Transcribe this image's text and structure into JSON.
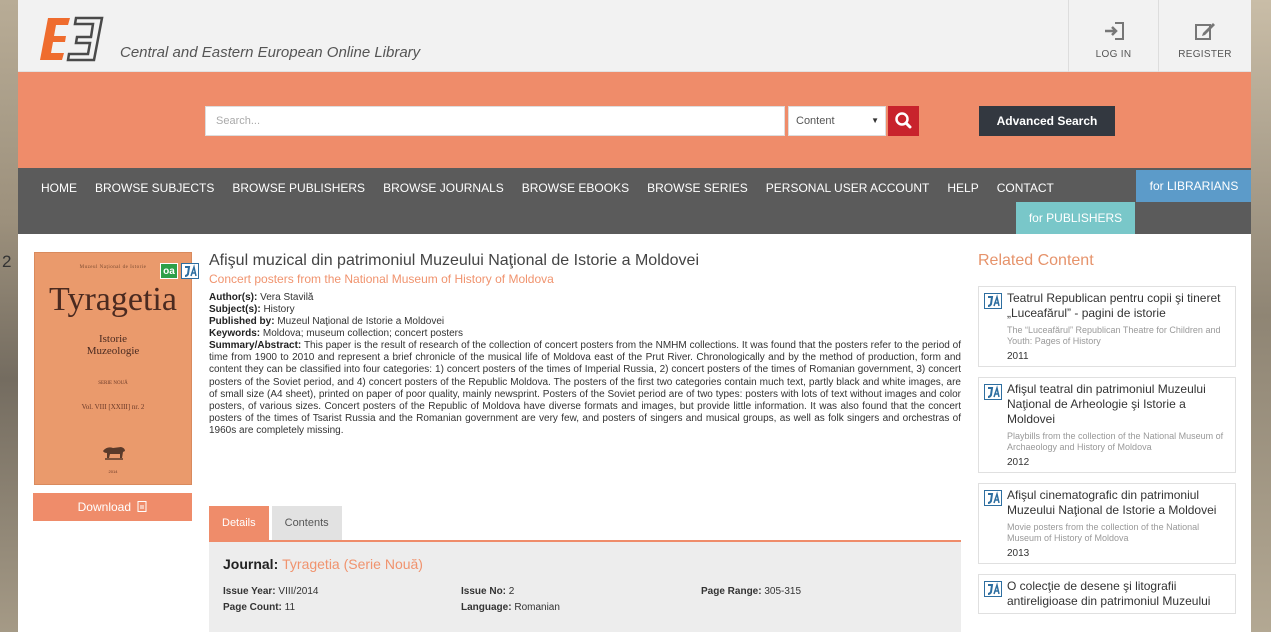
{
  "background": {
    "digit": "2"
  },
  "header": {
    "site_title": "Central and Eastern European Online Library",
    "login_label": "LOG IN",
    "register_label": "REGISTER"
  },
  "search": {
    "placeholder": "Search...",
    "select_value": "Content",
    "advanced_label": "Advanced Search"
  },
  "nav": {
    "items": [
      "HOME",
      "BROWSE SUBJECTS",
      "BROWSE PUBLISHERS",
      "BROWSE JOURNALS",
      "BROWSE EBOOKS",
      "BROWSE SERIES",
      "PERSONAL USER ACCOUNT",
      "HELP",
      "CONTACT"
    ],
    "for_librarians": "for LIBRARIANS",
    "for_publishers": "for PUBLISHERS"
  },
  "cover": {
    "top_text": "Muzeul Național de Istorie",
    "title": "Tyragetia",
    "subtitle1": "Istorie",
    "subtitle2": "Muzeologie",
    "series": "SERIE NOUĂ",
    "volume": "Vol. VIII [XXIII] nr. 2",
    "year": "2014",
    "badge_oa": "oa"
  },
  "download_label": "Download",
  "article": {
    "title": "Afişul muzical din patrimoniul Muzeului Naţional de Istorie a Moldovei",
    "subtitle": "Concert posters from the National Museum of History of Moldova",
    "authors_label": "Author(s):",
    "authors": "Vera Stavilă",
    "subjects_label": "Subject(s):",
    "subjects": "History",
    "published_label": "Published by:",
    "published": "Muzeul Naţional de Istorie a Moldovei",
    "keywords_label": "Keywords:",
    "keywords": "Moldova; museum collection; concert posters",
    "summary_label": "Summary/Abstract:",
    "summary": "This paper is the result of research of the collection of concert posters from the NMHM collections. It was found that the posters refer to the period of time from 1900 to 2010 and represent a brief chronicle of the musical life of Moldova east of the Prut River. Chronologically and by the method of production, form and content they can be classified into four categories: 1) concert posters of the times of Imperial Russia, 2) concert posters of the times of Romanian government, 3) concert posters of the Soviet period, and 4) concert posters of the Republic Moldova. The posters of the first two categories contain much text, partly black and white images, are of small size (A4 sheet), printed on paper of poor quality, mainly newsprint. Posters of the Soviet period are of two types: posters with lots of text without images and color posters, of various sizes. Concert posters of the Republic of Moldova have diverse formats and images, but provide little information. It was also found that the concert posters of the times of Tsarist Russia and the Romanian government are very few, and posters of singers and musical groups, as well as folk singers and orchestras of 1960s are completely missing."
  },
  "tabs": {
    "details": "Details",
    "contents": "Contents"
  },
  "details": {
    "journal_label": "Journal:",
    "journal_name": "Tyragetia (Serie Nouă)",
    "issue_year_label": "Issue Year:",
    "issue_year": "VIII/2014",
    "issue_no_label": "Issue No:",
    "issue_no": "2",
    "page_range_label": "Page Range:",
    "page_range": "305-315",
    "page_count_label": "Page Count:",
    "page_count": "11",
    "language_label": "Language:",
    "language": "Romanian"
  },
  "related": {
    "heading": "Related Content",
    "items": [
      {
        "title": "Teatrul Republican pentru copii şi tineret „Luceafărul” - pagini de istorie",
        "sub": "The “Luceafărul” Republican Theatre for Children and Youth: Pages of History",
        "year": "2011"
      },
      {
        "title": "Afişul teatral din patrimoniul Muzeului Naţional de Arheologie şi Istorie a Moldovei",
        "sub": "Playbills from the collection of the National Museum of Archaeology and History of Moldova",
        "year": "2012"
      },
      {
        "title": "Afişul cinematografic din patrimoniul Muzeului Naţional de Istorie a Moldovei",
        "sub": "Movie posters from the collection of the National Museum of History of Moldova",
        "year": "2013"
      },
      {
        "title": "O colecţie de desene şi litografii antireligioase din patrimoniul Muzeului",
        "sub": "",
        "year": ""
      }
    ]
  },
  "colors": {
    "accent": "#ef8c6a",
    "nav": "#5b5b5b",
    "search_btn": "#c8232c",
    "librarians": "#5c9bc9",
    "publishers": "#79c7c9",
    "dark_btn": "#333840"
  }
}
